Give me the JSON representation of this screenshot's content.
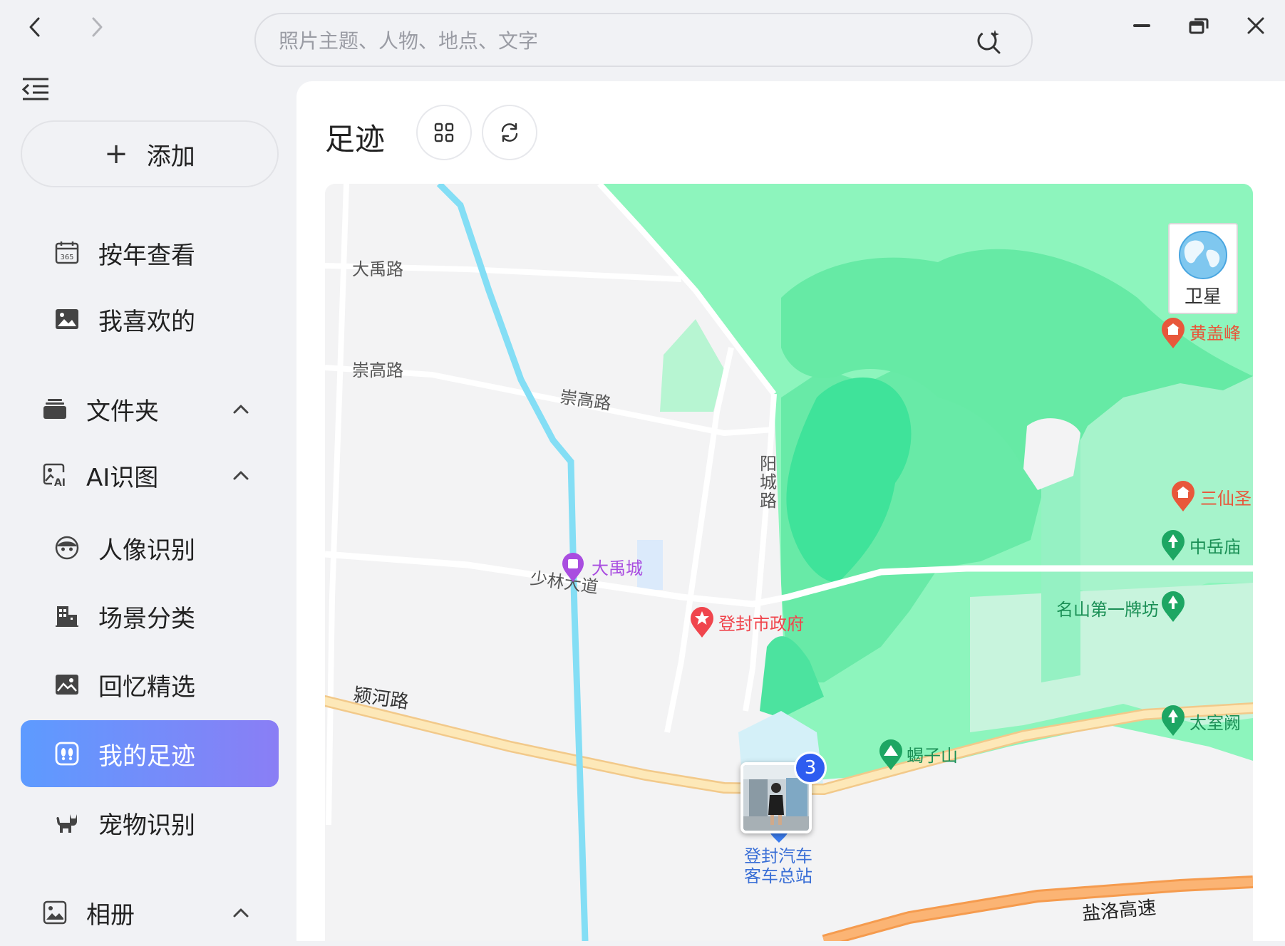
{
  "search": {
    "placeholder": "照片主题、人物、地点、文字"
  },
  "sidebar": {
    "add_label": "添加",
    "items": [
      {
        "label": "按年查看"
      },
      {
        "label": "我喜欢的"
      },
      {
        "label": "文件夹"
      },
      {
        "label": "AI识图"
      },
      {
        "label": "人像识别"
      },
      {
        "label": "场景分类"
      },
      {
        "label": "回忆精选"
      },
      {
        "label": "我的足迹"
      },
      {
        "label": "宠物识别"
      },
      {
        "label": "相册"
      }
    ]
  },
  "main": {
    "title": "足迹"
  },
  "map": {
    "satellite_label": "卫星",
    "roads": {
      "dayu": "大禹路",
      "chonggao_left": "崇高路",
      "chonggao_right": "崇高路",
      "yangcheng": "阳城路",
      "shaolin": "少林大道",
      "yinghe": "颍河路",
      "yanluo": "盐洛高速"
    },
    "pois": {
      "dayucheng": "大禹城",
      "gov": "登封市政府",
      "huanggaifeng": "黄盖峰",
      "sanxiansheng": "三仙圣",
      "zhongyuemiao": "中岳庙",
      "mingshan": "名山第一牌坊",
      "taishique": "太室阙",
      "xiezishan": "蝎子山",
      "bus_station_1": "登封汽车",
      "bus_station_2": "客车总站"
    },
    "cluster_count": "3"
  },
  "colors": {
    "accent_start": "#5d9bff",
    "accent_end": "#8a7ef5",
    "forest": "#6fefa7",
    "river": "#84def5",
    "highway": "#f9a35a",
    "main_road": "#fbe2a6",
    "poi_green": "#1da663",
    "poi_red": "#f0454d",
    "poi_purple": "#a94de0",
    "poi_orange": "#e8573b"
  }
}
